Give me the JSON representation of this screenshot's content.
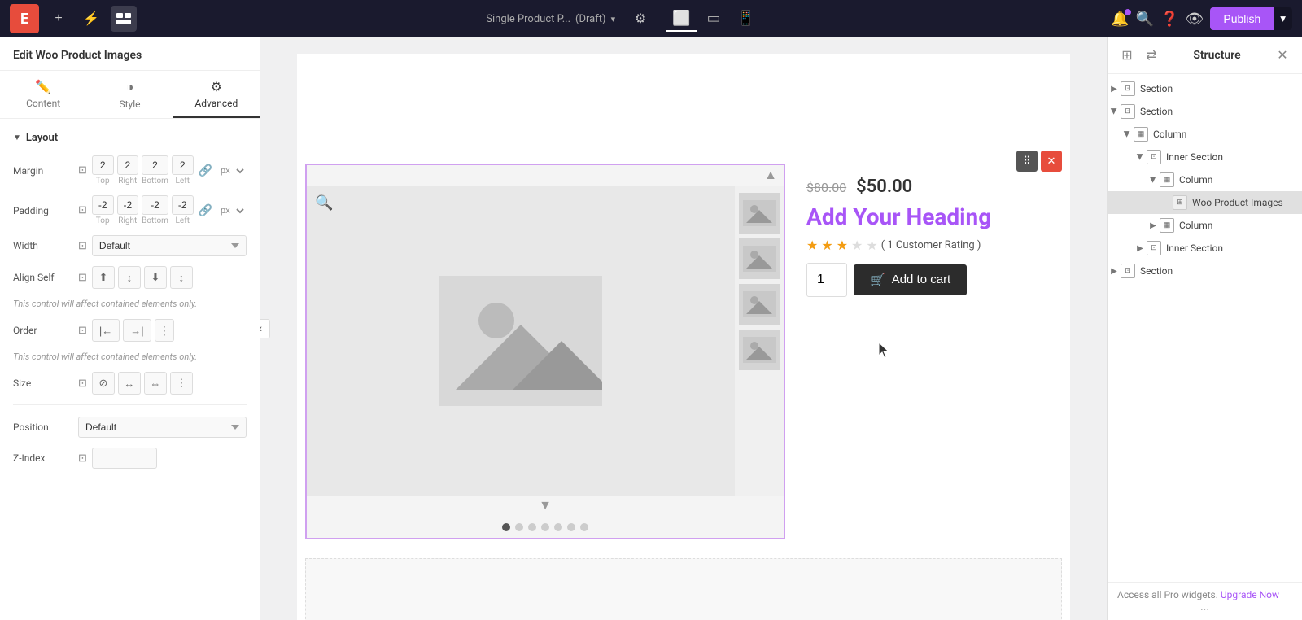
{
  "topbar": {
    "logo_text": "E",
    "page_title": "Single Product P...",
    "page_status": "(Draft)",
    "buttons": {
      "add": "+",
      "settings": "⚡",
      "structure": "☰",
      "gear": "⚙",
      "publish": "Publish"
    },
    "devices": [
      "desktop",
      "tablet",
      "mobile"
    ],
    "icons": {
      "bell": "🔔",
      "search": "🔍",
      "help": "❓",
      "eye": "👁"
    }
  },
  "left_panel": {
    "title": "Edit Woo Product Images",
    "tabs": [
      {
        "id": "content",
        "label": "Content",
        "icon": "✏️"
      },
      {
        "id": "style",
        "label": "Style",
        "icon": "◑"
      },
      {
        "id": "advanced",
        "label": "Advanced",
        "icon": "⚙"
      }
    ],
    "active_tab": "advanced",
    "layout": {
      "section_label": "Layout",
      "margin": {
        "label": "Margin",
        "unit": "px",
        "top": "2",
        "right": "2",
        "bottom": "2",
        "left": "2"
      },
      "padding": {
        "label": "Padding",
        "unit": "px",
        "top": "-2",
        "right": "-2",
        "bottom": "-2",
        "left": "-2"
      },
      "width": {
        "label": "Width",
        "value": "Default"
      },
      "align_self": {
        "label": "Align Self",
        "hint": "This control will affect contained elements only."
      },
      "order": {
        "label": "Order",
        "hint": "This control will affect contained elements only."
      },
      "size": {
        "label": "Size"
      },
      "position": {
        "label": "Position",
        "value": "Default"
      },
      "z_index": {
        "label": "Z-Index"
      }
    }
  },
  "product_widget": {
    "price_old": "$80.00",
    "price_new": "$50.00",
    "heading": "Add Your Heading",
    "rating_text": "( 1 Customer Rating )",
    "quantity": "1",
    "add_to_cart_label": "Add to cart",
    "dots": 7
  },
  "structure_panel": {
    "title": "Structure",
    "items": [
      {
        "id": "section1",
        "label": "Section",
        "indent": 0,
        "expanded": false,
        "type": "section"
      },
      {
        "id": "section2",
        "label": "Section",
        "indent": 0,
        "expanded": true,
        "type": "section"
      },
      {
        "id": "column1",
        "label": "Column",
        "indent": 1,
        "expanded": true,
        "type": "column"
      },
      {
        "id": "inner_section1",
        "label": "Inner Section",
        "indent": 2,
        "expanded": true,
        "type": "inner_section"
      },
      {
        "id": "column2",
        "label": "Column",
        "indent": 3,
        "expanded": true,
        "type": "column"
      },
      {
        "id": "woo_product_images",
        "label": "Woo Product Images",
        "indent": 4,
        "expanded": false,
        "type": "widget",
        "selected": true
      },
      {
        "id": "column3",
        "label": "Column",
        "indent": 3,
        "expanded": false,
        "type": "column"
      },
      {
        "id": "inner_section2",
        "label": "Inner Section",
        "indent": 2,
        "expanded": false,
        "type": "inner_section"
      },
      {
        "id": "section3",
        "label": "Section",
        "indent": 0,
        "expanded": false,
        "type": "section"
      }
    ],
    "footer": {
      "text": "Access all Pro widgets.",
      "upgrade_label": "Upgrade Now",
      "more": "..."
    }
  }
}
